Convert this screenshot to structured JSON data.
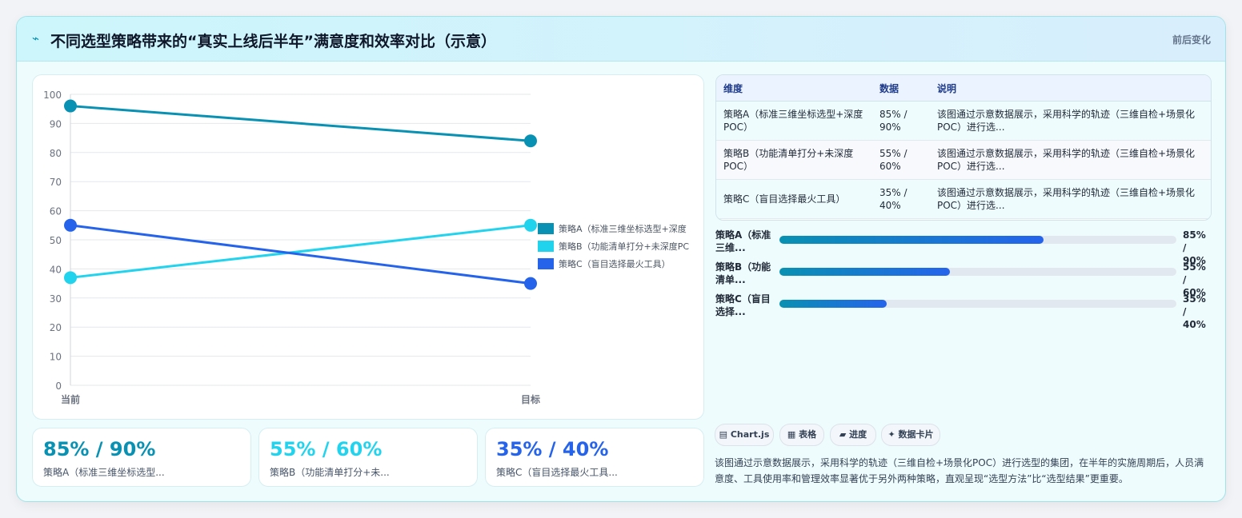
{
  "header": {
    "icon": "lightning-icon",
    "title": "不同选型策略带来的“真实上线后半年”满意度和效率对比（示意）",
    "badge": "前后变化"
  },
  "chart_data": {
    "type": "line",
    "categories": [
      "当前",
      "目标"
    ],
    "ylim": [
      0,
      100
    ],
    "yticks": [
      "0",
      "10",
      "20",
      "30",
      "40",
      "50",
      "60",
      "70",
      "80",
      "90",
      "100"
    ],
    "series": [
      {
        "name": "策略A（标准三维坐标选型+深度POC）",
        "legend_text": "策略A（标准三维坐标选型+深度",
        "values": [
          96,
          84
        ],
        "color": "#0891b2"
      },
      {
        "name": "策略B（功能清单打分+未深度POC）",
        "legend_text": "策略B（功能清单打分+未深度PC",
        "values": [
          37,
          55
        ],
        "color": "#22d3ee"
      },
      {
        "name": "策略C（盲目选择最火工具）",
        "legend_text": "策略C（盲目选择最火工具）",
        "values": [
          55,
          35
        ],
        "color": "#2563eb"
      }
    ]
  },
  "stats": [
    {
      "value": "85% / 90%",
      "label": "策略A（标准三维坐标选型...",
      "color": "#0891b2"
    },
    {
      "value": "55% / 60%",
      "label": "策略B（功能清单打分+未...",
      "color": "#22d3ee"
    },
    {
      "value": "35% / 40%",
      "label": "策略C（盲目选择最火工具...",
      "color": "#2563eb"
    }
  ],
  "table": {
    "headers": [
      "维度",
      "数据",
      "说明"
    ],
    "rows": [
      {
        "dim": "策略A（标准三维坐标选型+深度POC）",
        "data": "85% / 90%",
        "note": "该图通过示意数据展示，采用科学的轨迹（三维自检+场景化POC）进行选..."
      },
      {
        "dim": "策略B（功能清单打分+未深度POC）",
        "data": "55% / 60%",
        "note": "该图通过示意数据展示，采用科学的轨迹（三维自检+场景化POC）进行选..."
      },
      {
        "dim": "策略C（盲目选择最火工具）",
        "data": "35% / 40%",
        "note": "该图通过示意数据展示，采用科学的轨迹（三维自检+场景化POC）进行选..."
      }
    ]
  },
  "progress": [
    {
      "label": "策略A（标准三维...",
      "value": "85% / 90%",
      "fraction": 0.665
    },
    {
      "label": "策略B（功能清单...",
      "value": "55% / 60%",
      "fraction": 0.43
    },
    {
      "label": "策略C（盲目选择...",
      "value": "35% / 40%",
      "fraction": 0.27
    }
  ],
  "chips": [
    {
      "icon": "chart-icon",
      "glyph": "▤",
      "label": "Chart.js"
    },
    {
      "icon": "table-icon",
      "glyph": "▦",
      "label": "表格"
    },
    {
      "icon": "progress-icon",
      "glyph": "▰",
      "label": "进度"
    },
    {
      "icon": "sparkle-icon",
      "glyph": "✦",
      "label": "数据卡片"
    }
  ],
  "description": "该图通过示意数据展示，采用科学的轨迹（三维自检+场景化POC）进行选型的集团，在半年的实施周期后，人员满意度、工具使用率和管理效率显著优于另外两种策略，直观呈现“选型方法”比“选型结果”更重要。"
}
